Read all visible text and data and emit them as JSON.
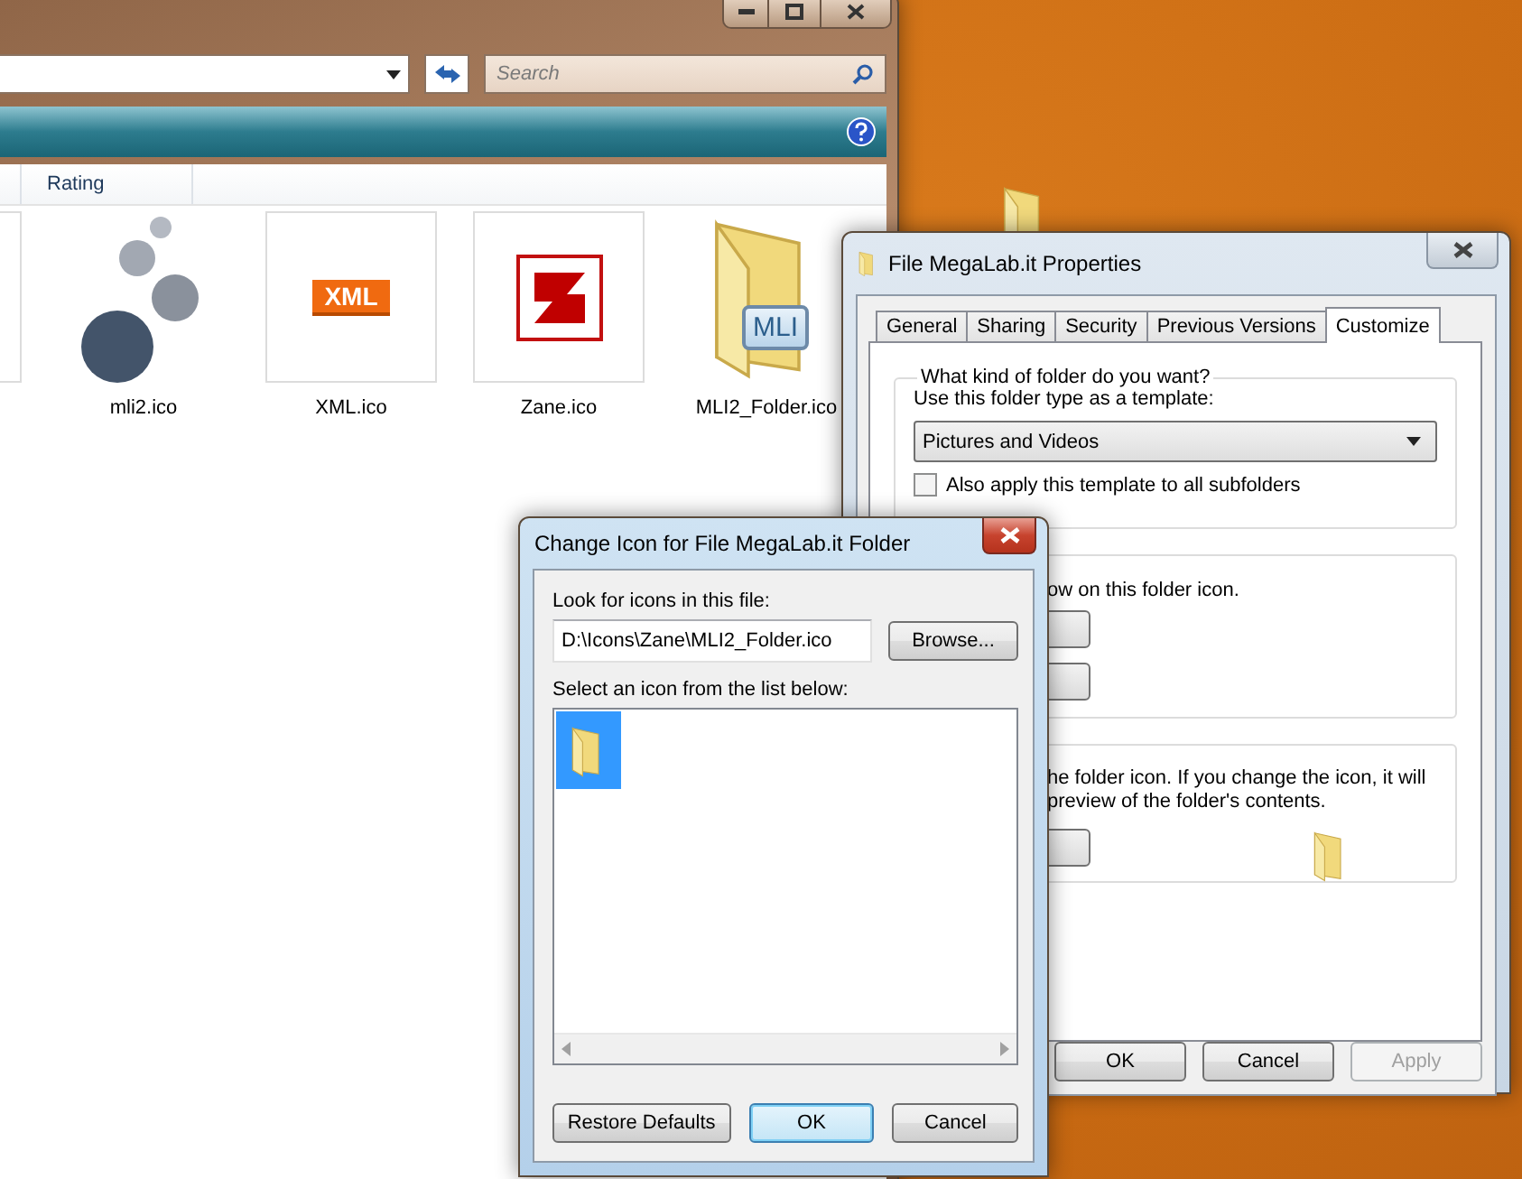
{
  "explorer": {
    "search": {
      "placeholder": "Search"
    },
    "columns": [
      {
        "label": "Rating"
      }
    ],
    "items": [
      {
        "kind": "blank"
      },
      {
        "kind": "bubbles",
        "name": "mli2.ico"
      },
      {
        "kind": "xml",
        "name": "XML.ico",
        "badge": "XML"
      },
      {
        "kind": "zane",
        "name": "Zane.ico"
      },
      {
        "kind": "folder",
        "name": "MLI2_Folder.ico",
        "badge": "MLI"
      }
    ]
  },
  "properties": {
    "title": "File MegaLab.it Properties",
    "tabs": [
      {
        "label": "General",
        "selected": false
      },
      {
        "label": "Sharing",
        "selected": false
      },
      {
        "label": "Security",
        "selected": false
      },
      {
        "label": "Previous Versions",
        "selected": false
      },
      {
        "label": "Customize",
        "selected": true
      }
    ],
    "group_title": "What kind of folder do you want?",
    "template_label": "Use this folder type as a template:",
    "template": "Pictures and Videos",
    "subfolders": {
      "label": "Also apply this template to all subfolders",
      "checked": false
    },
    "pictures_text": "ow on this folder icon.",
    "icon_text": [
      "he folder icon. If you change the icon, it will",
      "preview of the folder's contents."
    ],
    "buttons": [
      {
        "label": "OK",
        "disabled": false
      },
      {
        "label": "Cancel",
        "disabled": false
      },
      {
        "label": "Apply",
        "disabled": true
      }
    ]
  },
  "change_icon": {
    "title": "Change Icon for File MegaLab.it Folder",
    "file_label": "Look for icons in this file:",
    "file_value": "D:\\Icons\\Zane\\MLI2_Folder.ico",
    "browse": "Browse...",
    "list_label": "Select an icon from the list below:",
    "icons": [
      {
        "selected": true
      }
    ],
    "buttons": [
      {
        "label": "Restore Defaults",
        "default": false
      },
      {
        "label": "OK",
        "default": true
      },
      {
        "label": "Cancel",
        "default": false
      }
    ]
  }
}
